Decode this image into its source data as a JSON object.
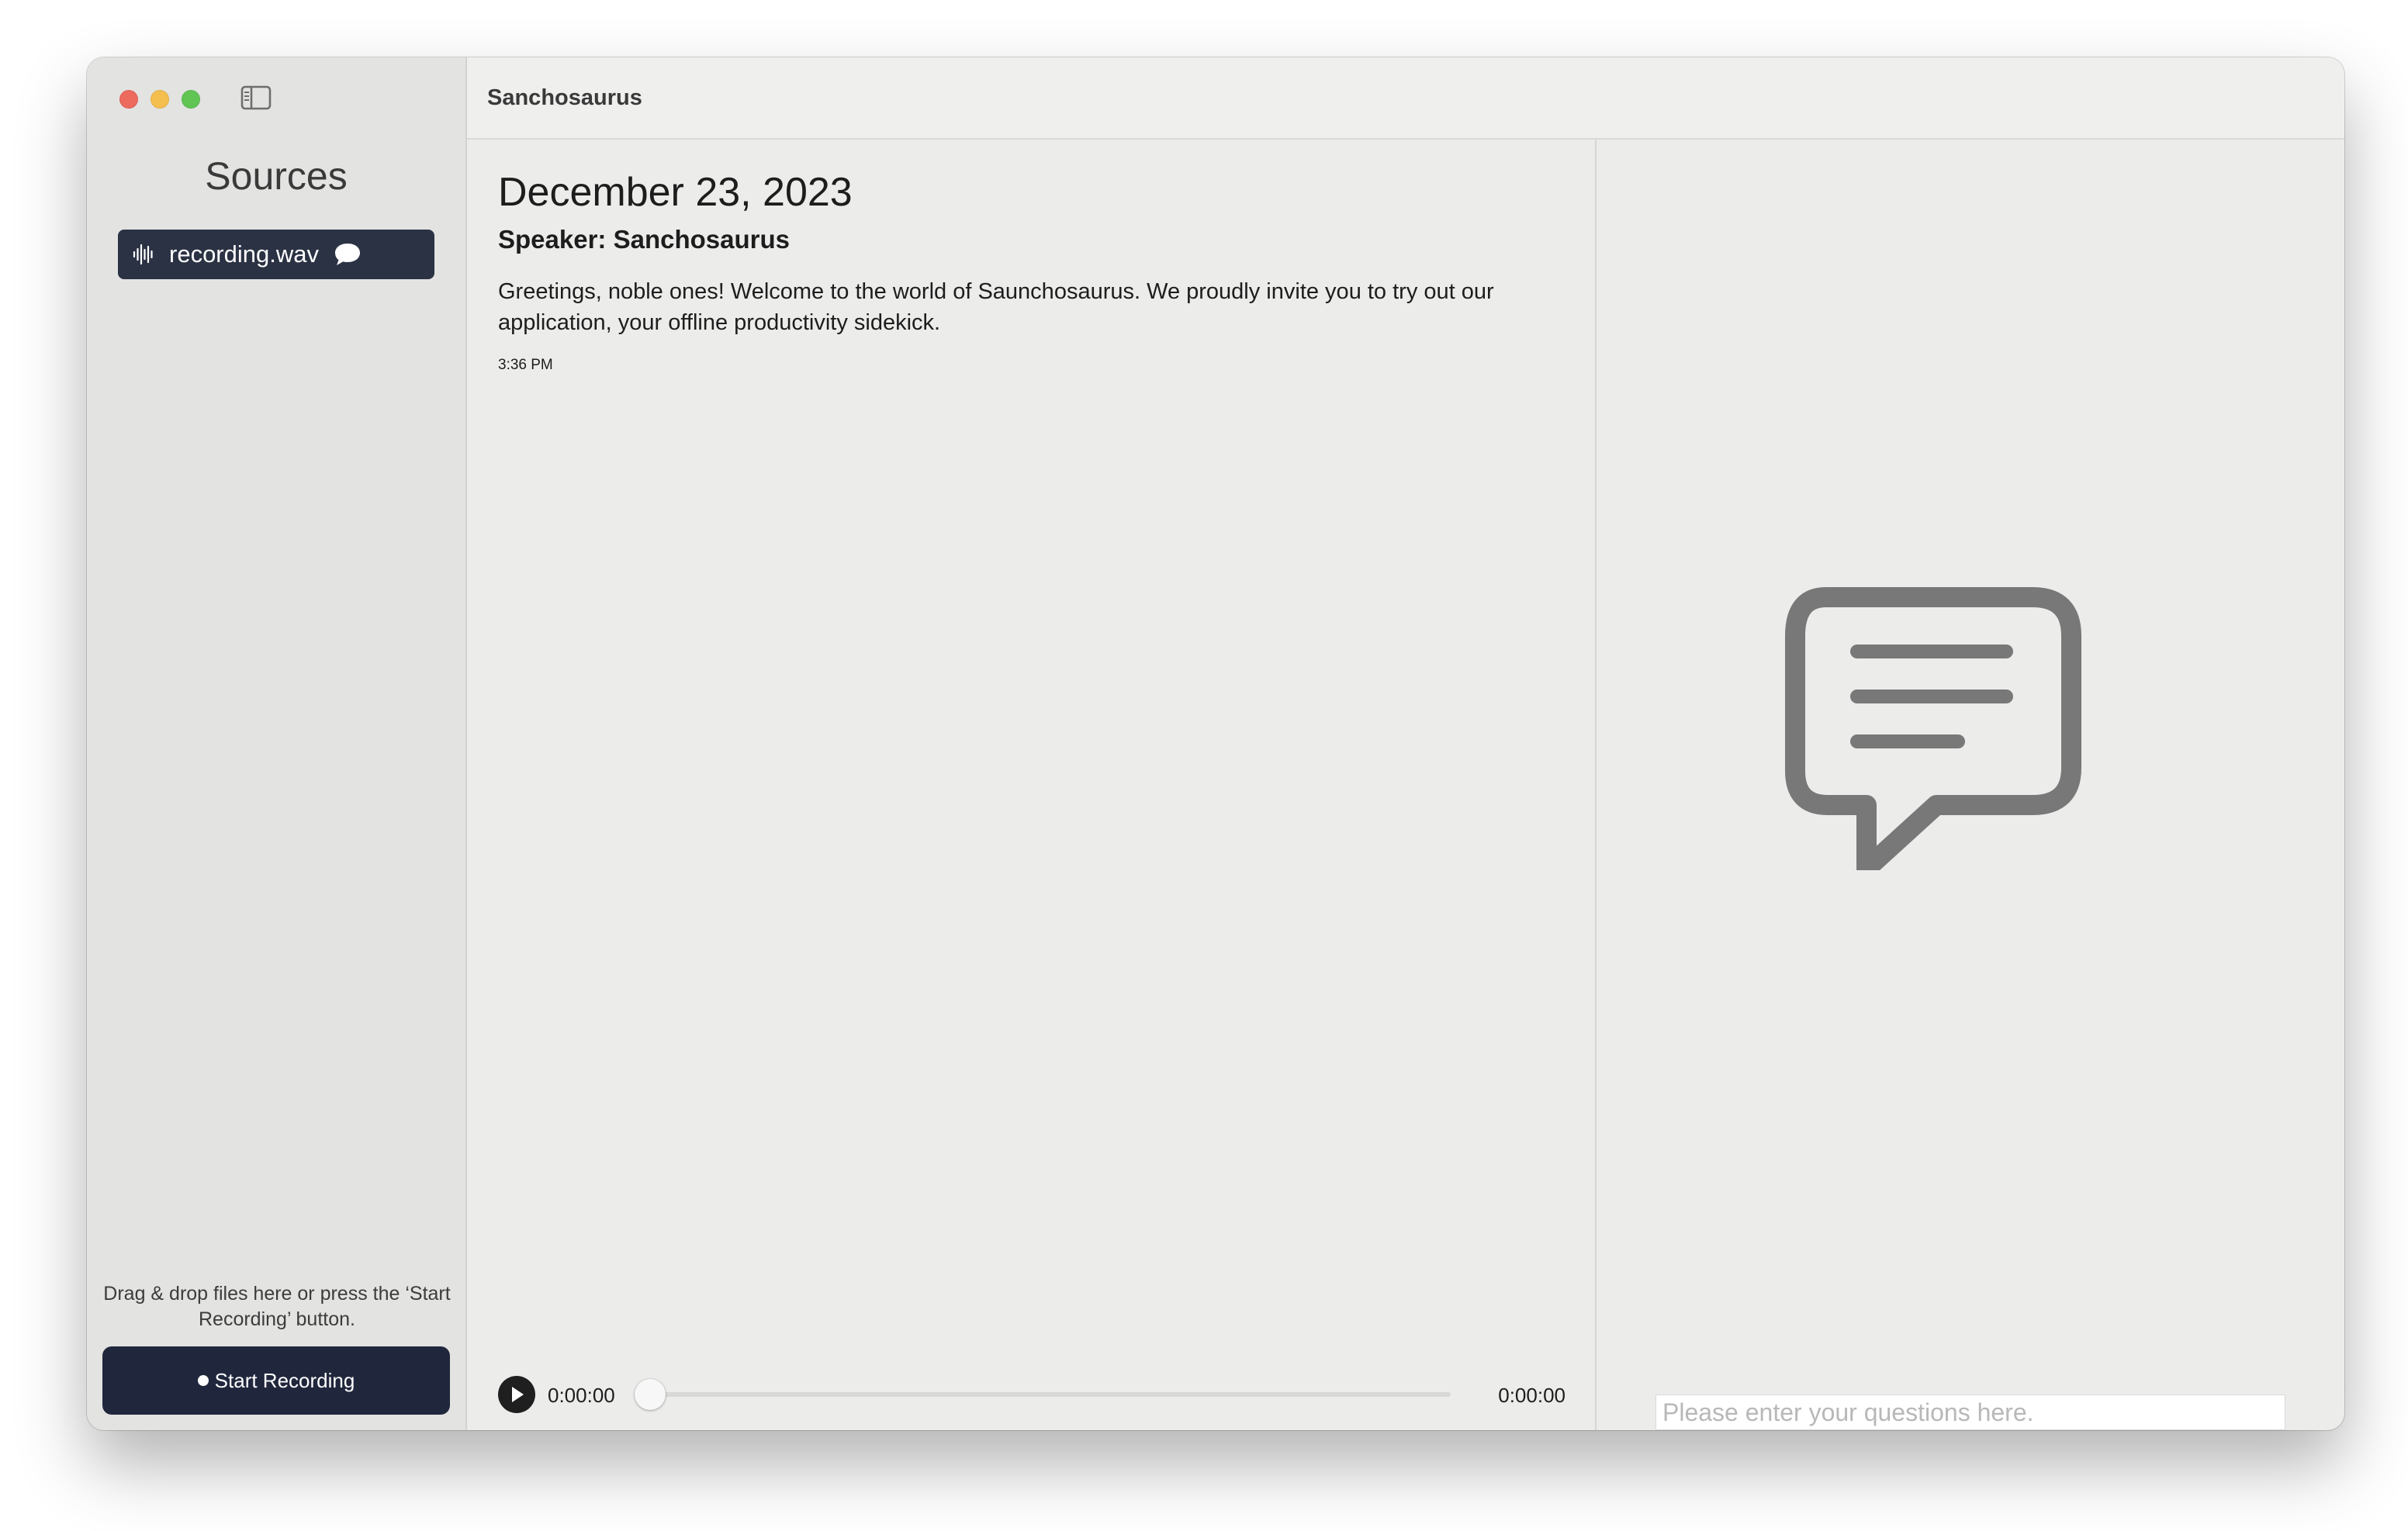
{
  "window": {
    "title": "Sanchosaurus"
  },
  "sidebar": {
    "title": "Sources",
    "items": [
      {
        "label": "recording.wav",
        "icon": "waveform-icon",
        "badge_icon": "speech-bubble-icon"
      }
    ],
    "drop_hint": "Drag & drop files here or press the ‘Start Recording’ button.",
    "record_button": "Start Recording"
  },
  "transcript": {
    "date": "December 23, 2023",
    "speaker": "Speaker: Sanchosaurus",
    "message": "Greetings, noble ones! Welcome to the world of Saunchosaurus. We proudly invite you to try out our application, your offline productivity sidekick.",
    "timestamp": "3:36 PM"
  },
  "player": {
    "current_time": "0:00:00",
    "total_time": "0:00:00",
    "progress": 0
  },
  "chat": {
    "placeholder": "Please enter your questions here.",
    "value": "",
    "empty_icon": "chat-bubble-icon"
  },
  "colors": {
    "accent": "#2b3244",
    "record_button": "#20273d",
    "icon_gray": "#787878"
  }
}
